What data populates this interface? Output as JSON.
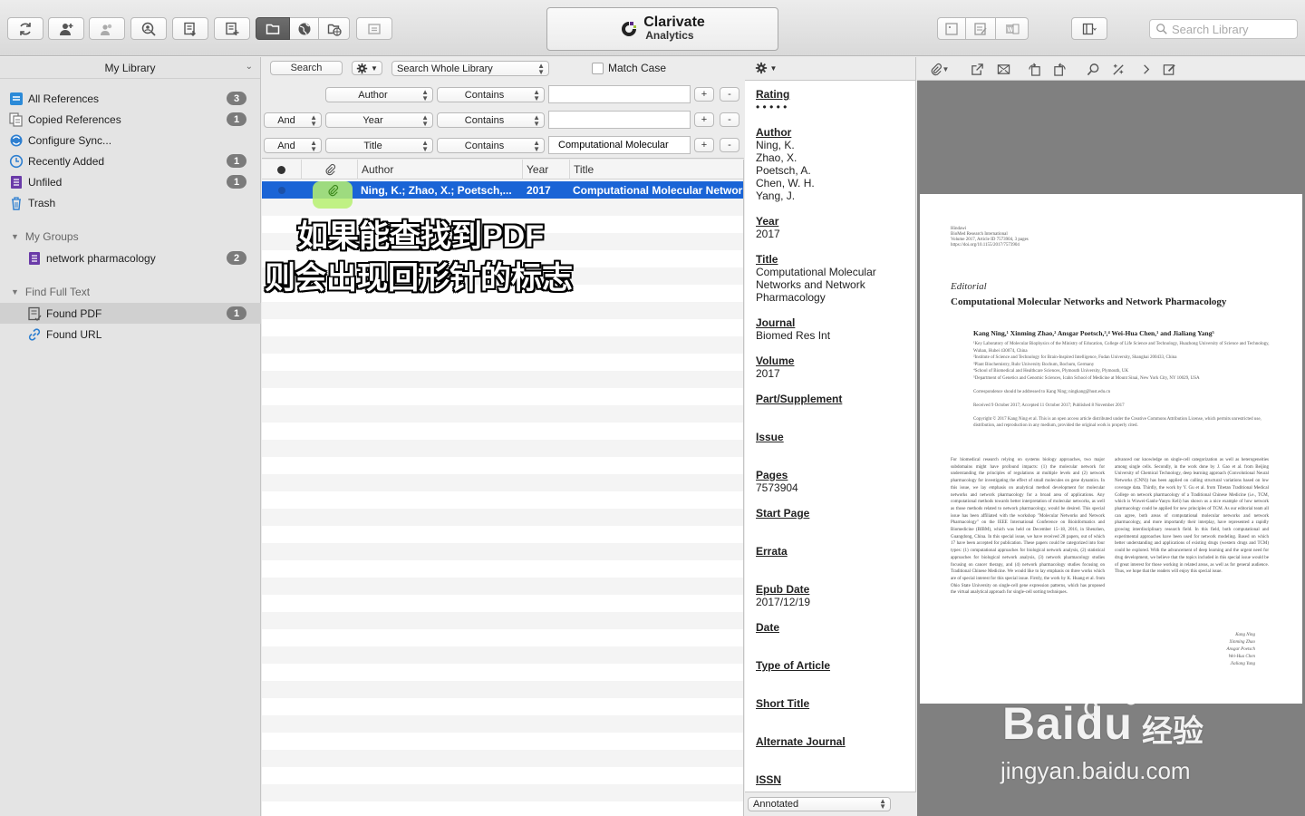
{
  "toolbar": {
    "logo_name": "Clarivate",
    "logo_sub": "Analytics",
    "search_placeholder": "Search Library"
  },
  "sidebar": {
    "title": "My Library",
    "items": [
      {
        "label": "All References",
        "count": "3",
        "icon": "all-references-icon"
      },
      {
        "label": "Copied References",
        "count": "1",
        "icon": "copied-references-icon"
      },
      {
        "label": "Configure Sync...",
        "count": "",
        "icon": "sync-icon"
      },
      {
        "label": "Recently Added",
        "count": "1",
        "icon": "clock-icon"
      },
      {
        "label": "Unfiled",
        "count": "1",
        "icon": "unfiled-icon"
      },
      {
        "label": "Trash",
        "count": "",
        "icon": "trash-icon"
      }
    ],
    "groups": [
      {
        "label": "My Groups",
        "items": [
          {
            "label": "network pharmacology",
            "count": "2"
          }
        ]
      },
      {
        "label": "Find Full Text",
        "items": [
          {
            "label": "Found PDF",
            "count": "1"
          },
          {
            "label": "Found URL",
            "count": ""
          }
        ]
      }
    ]
  },
  "search": {
    "search_button": "Search",
    "scope": "Search Whole Library",
    "match_case": "Match Case",
    "rows": [
      {
        "bool": "",
        "field": "Author",
        "op": "Contains",
        "value": ""
      },
      {
        "bool": "And",
        "field": "Year",
        "op": "Contains",
        "value": ""
      },
      {
        "bool": "And",
        "field": "Title",
        "op": "Contains",
        "value": "Computational Molecular"
      }
    ],
    "plus": "+",
    "minus": "-"
  },
  "ref_list": {
    "columns": {
      "author": "Author",
      "year": "Year",
      "title": "Title"
    },
    "rows": [
      {
        "author": "Ning, K.; Zhao, X.; Poetsch,...",
        "year": "2017",
        "title": "Computational Molecular Networks and Network Pharmacology"
      }
    ]
  },
  "annotation": {
    "line1": "如果能查找到PDF",
    "line2": "则会出现回形针的标志"
  },
  "detail": {
    "fields": [
      {
        "label": "Rating",
        "value": "• • • • •"
      },
      {
        "label": "Author",
        "value": "Ning, K.\nZhao, X.\nPoetsch, A.\nChen, W. H.\nYang, J."
      },
      {
        "label": "Year",
        "value": "2017"
      },
      {
        "label": "Title",
        "value": "Computational Molecular\nNetworks and Network\nPharmacology"
      },
      {
        "label": "Journal",
        "value": "Biomed Res Int"
      },
      {
        "label": "Volume",
        "value": "2017"
      },
      {
        "label": "Part/Supplement",
        "value": ""
      },
      {
        "label": "Issue",
        "value": ""
      },
      {
        "label": "Pages",
        "value": "7573904"
      },
      {
        "label": "Start Page",
        "value": ""
      },
      {
        "label": "Errata",
        "value": ""
      },
      {
        "label": "Epub Date",
        "value": "2017/12/19"
      },
      {
        "label": "Date",
        "value": ""
      },
      {
        "label": "Type of Article",
        "value": ""
      },
      {
        "label": "Short Title",
        "value": ""
      },
      {
        "label": "Alternate Journal",
        "value": ""
      },
      {
        "label": "ISSN",
        "value": ""
      }
    ],
    "bottom_select": "Annotated"
  },
  "pdf": {
    "header": "Hindawi\nBioMed Research International\nVolume 2017, Article ID 7573904, 3 pages\nhttps://doi.org/10.1155/2017/7573904",
    "section": "Editorial",
    "title": "Computational Molecular Networks and Network Pharmacology",
    "authors": "Kang Ning,¹ Xinming Zhao,² Ansgar Poetsch,³,⁴ Wei-Hua Chen,¹ and Jialiang Yang⁵",
    "affiliations": "¹Key Laboratory of Molecular Biophysics of the Ministry of Education, College of Life Science and Technology, Huazhong University of Science and Technology, Wuhan, Hubei 430074, China\n²Institute of Science and Technology for Brain-Inspired Intelligence, Fudan University, Shanghai 200433, China\n³Plant Biochemistry, Ruhr University Bochum, Bochum, Germany\n⁴School of Biomedical and Healthcare Sciences, Plymouth University, Plymouth, UK\n⁵Department of Genetics and Genomic Sciences, Icahn School of Medicine at Mount Sinai, New York City, NY 10029, USA\n\nCorrespondence should be addressed to Kang Ning; ningkang@hust.edu.cn\n\nReceived 9 October 2017; Accepted 11 October 2017; Published 8 November 2017\n\nCopyright © 2017 Kang Ning et al. This is an open access article distributed under the Creative Commons Attribution License, which permits unrestricted use, distribution, and reproduction in any medium, provided the original work is properly cited.",
    "body_left": "For biomedical research relying on systems biology approaches, two major subdomains might have profound impacts: (1) the molecular network for understanding the principles of regulations at multiple levels and (2) network pharmacology for investigating the effect of small molecules on gene dynamics. In this issue, we lay emphasis on analytical method development for molecular networks and network pharmacology for a broad area of applications. Any computational methods towards better interpretation of molecular networks, as well as those methods related to network pharmacology, would be desired. This special issue has been affiliated with the workshop \"Molecular Networks and Network Pharmacology\" on the IEEE International Conference on Bioinformatics and Biomedicine (BIBM), which was held on December 15–18, 2016, in Shenzhen, Guangdong, China. In this special issue, we have received 28 papers, out of which 17 have been accepted for publication. These papers could be categorized into four types: (1) computational approaches for biological network analysis, (2) statistical approaches for biological network analysis, (3) network pharmacology studies focusing on cancer therapy, and (4) network pharmacology studies focusing on Traditional Chinese Medicine. We would like to lay emphasis on three works which are of special interest for this special issue. Firstly, the work by K. Huang et al. from Ohio State University on single-cell gene expression patterns, which has proposed the virtual analytical approach for single-cell sorting techniques.",
    "body_right": "advanced our knowledge on single-cell categorization as well as heterogeneities among single cells. Secondly, in the work done by J. Gao et al. from Beijing University of Chemical Technology, deep learning approach (Convolutional Neural Networks (CNN)) has been applied on calling structural variations based on low coverage data. Thirdly, the work by Y. Gu et al. from Tibetan Traditional Medical College on network pharmacology of a Traditional Chinese Medicine (i.e., TCM, which is Wuwei-Ganlu-Yaoyu Keli) has shown us a nice example of how network pharmacology could be applied for new principles of TCM. As our editorial team all can agree, both areas of computational molecular networks and network pharmacology, and more importantly their interplay, have represented a rapidly growing interdisciplinary research field. In this field, both computational and experimental approaches have been used for network modeling. Based on which better understanding and applications of existing drugs (western drugs and TCM) could be explored. With the advancement of deep learning and the urgent need for drug development, we believe that the topics included in this special issue would be of great interest for those working in related areas, as well as for general audience. Thus, we hope that the readers will enjoy this special issue.",
    "signatures": "Kang Ning\nXinming Zhao\nAnsgar Poetsch\nWei-Hua Chen\nJialiang Yang"
  },
  "watermark": {
    "brand": "Bai",
    "du": "du",
    "cn": "经验",
    "url": "jingyan.baidu.com"
  }
}
